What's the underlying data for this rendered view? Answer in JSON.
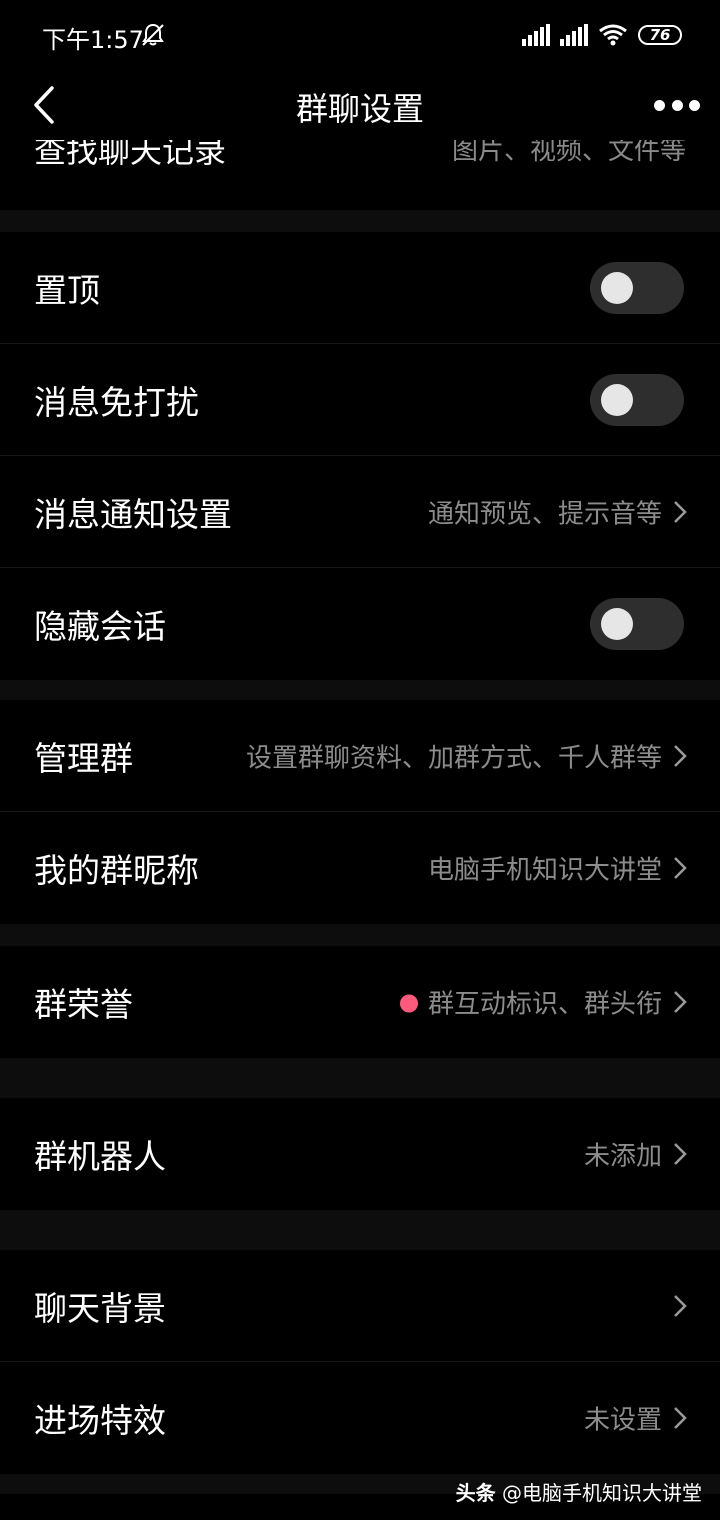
{
  "status_bar": {
    "time": "下午1:57",
    "battery": "76",
    "icons": [
      "bell-muted-icon",
      "signal-icon",
      "signal-icon",
      "wifi-icon",
      "battery-icon"
    ]
  },
  "header": {
    "title": "群聊设置",
    "back_icon": "back-arrow-icon",
    "more_icon": "more-dots-icon"
  },
  "cut_row": {
    "label": "查找聊天记录",
    "value": "图片、视频、文件等"
  },
  "group1": {
    "pin": {
      "label": "置顶",
      "on": false
    },
    "mute": {
      "label": "消息免打扰",
      "on": false
    },
    "notify": {
      "label": "消息通知设置",
      "value": "通知预览、提示音等"
    },
    "hide": {
      "label": "隐藏会话",
      "on": false
    }
  },
  "group2": {
    "manage": {
      "label": "管理群",
      "value": "设置群聊资料、加群方式、千人群等"
    },
    "nickname": {
      "label": "我的群昵称",
      "value": "电脑手机知识大讲堂"
    }
  },
  "group3": {
    "honor": {
      "label": "群荣誉",
      "value": "群互动标识、群头衔"
    }
  },
  "group4": {
    "robot": {
      "label": "群机器人",
      "value": "未添加"
    }
  },
  "group5": {
    "background": {
      "label": "聊天背景",
      "value": ""
    },
    "effect": {
      "label": "进场特效",
      "value": "未设置"
    }
  },
  "colors": {
    "background": "#000000",
    "text": "#ffffff",
    "secondary_text": "#8c8c8c",
    "toggle_off": "#2e2e2e",
    "red_dot": "#ff5a7a"
  },
  "watermark": {
    "brand": "头条",
    "handle": "@电脑手机知识大讲堂"
  }
}
